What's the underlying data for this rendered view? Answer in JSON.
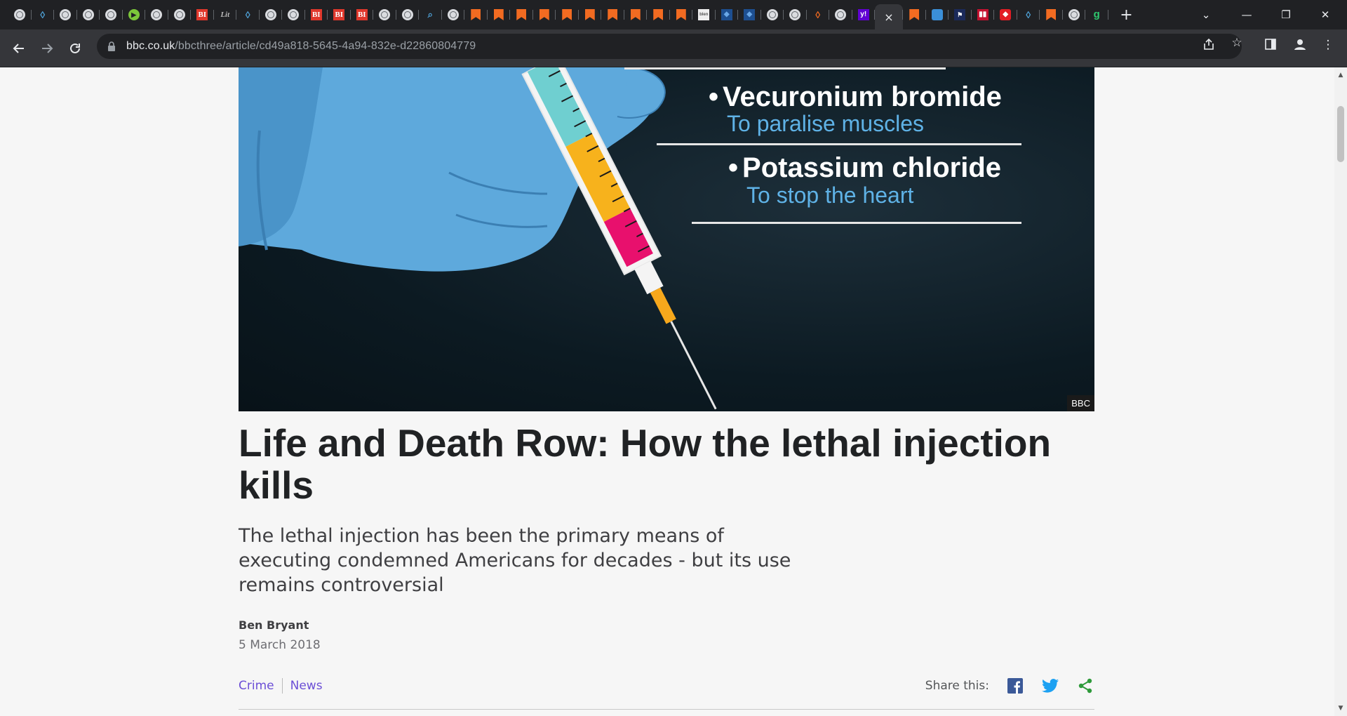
{
  "browser": {
    "url_host": "bbc.co.uk",
    "url_path": "/bbcthree/article/cd49a818-5645-4a94-832e-d22860804779",
    "active_tab_close": "×",
    "new_tab": "+",
    "favicon_labels": {
      "bi": "BI",
      "lit": "Lit",
      "yahoo": "y!",
      "g": "g",
      "cube": "◆",
      "crest": "⚑",
      "red": "◆",
      "small": "blen"
    },
    "tab_favicons": [
      "globe",
      "shield",
      "globe",
      "globe",
      "globe",
      "play",
      "globe",
      "globe",
      "bi",
      "lit",
      "shield",
      "globe",
      "globe",
      "bi",
      "bi",
      "bi",
      "globe",
      "globe",
      "search",
      "globe",
      "bookmark",
      "bookmark",
      "bookmark",
      "bookmark",
      "bookmark",
      "bookmark",
      "bookmark",
      "bookmark",
      "bookmark",
      "bookmark",
      "small-img",
      "cube",
      "cube",
      "globe",
      "globe",
      "shield-o",
      "globe",
      "yahoo",
      "ACTIVE",
      "bookmark",
      "pill",
      "crest",
      "bars",
      "red",
      "shield",
      "bookmark",
      "globe",
      "g"
    ]
  },
  "hero": {
    "drug1": "Vecuronium bromide",
    "purpose1": "To paralise muscles",
    "drug2": "Potassium chloride",
    "purpose2": "To stop the heart",
    "credit": "BBC"
  },
  "article": {
    "headline": "Life and Death Row: How the lethal injection kills",
    "standfirst": "The lethal injection has been the primary means of executing condemned Americans for decades - but its use remains controversial",
    "author": "Ben Bryant",
    "date": "5 March 2018",
    "tags": [
      "Crime",
      "News"
    ],
    "share_label": "Share this:"
  },
  "colors": {
    "chrome_dark": "#202124",
    "toolbar": "#35363a",
    "tag_link": "#6c4fd6",
    "facebook": "#3b5998",
    "twitter": "#1da1f2",
    "share_green": "#2e9a3a",
    "syringe_teal": "#6fcfd0",
    "syringe_yellow": "#f7b21c",
    "syringe_pink": "#e8106d",
    "glove_blue": "#5ea9dc"
  }
}
